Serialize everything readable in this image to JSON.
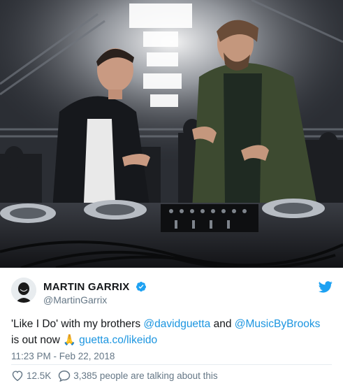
{
  "photo": {
    "alt_subject": "concert-stage-photo"
  },
  "tweet": {
    "author_name": "MARTIN GARRIX",
    "author_handle": "@MartinGarrix",
    "text_part1": "'Like I Do' with my brothers ",
    "mention1": "@davidguetta",
    "text_part2": " and ",
    "mention2": "@MusicByBrooks",
    "text_part3": " is out now ",
    "emoji": "🙏",
    "link": "guetta.co/likeido",
    "timestamp": "11:23 PM - Feb 22, 2018",
    "likes": "12.5K",
    "talking": "3,385 people are talking about this"
  },
  "colors": {
    "link": "#1b95e0",
    "verified": "#1da1f2",
    "muted": "#657786",
    "text": "#14171a"
  }
}
